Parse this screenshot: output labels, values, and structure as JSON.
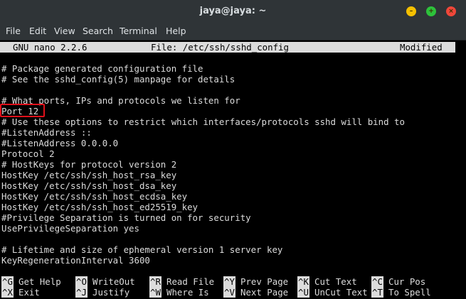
{
  "window": {
    "title": "jaya@jaya: ~",
    "buttons": {
      "minimize": "minimize",
      "maximize": "maximize",
      "close": "close"
    }
  },
  "menu": [
    "File",
    "Edit",
    "View",
    "Search",
    "Terminal",
    "Help"
  ],
  "nano": {
    "version": "GNU nano 2.2.6",
    "file": "File: /etc/ssh/sshd_config",
    "status": "Modified"
  },
  "file_lines": [
    "# Package generated configuration file",
    "# See the sshd_config(5) manpage for details",
    "",
    "# What ports, IPs and protocols we listen for",
    "Port 12",
    "# Use these options to restrict which interfaces/protocols sshd will bind to",
    "#ListenAddress ::",
    "#ListenAddress 0.0.0.0",
    "Protocol 2",
    "# HostKeys for protocol version 2",
    "HostKey /etc/ssh/ssh_host_rsa_key",
    "HostKey /etc/ssh/ssh_host_dsa_key",
    "HostKey /etc/ssh/ssh_host_ecdsa_key",
    "HostKey /etc/ssh/ssh_host_ed25519_key",
    "#Privilege Separation is turned on for security",
    "UsePrivilegeSeparation yes",
    "",
    "# Lifetime and size of ephemeral version 1 server key",
    "KeyRegenerationInterval 3600"
  ],
  "shortcuts_row1": [
    {
      "key": "^G",
      "label": "Get Help"
    },
    {
      "key": "^O",
      "label": "WriteOut"
    },
    {
      "key": "^R",
      "label": "Read File"
    },
    {
      "key": "^Y",
      "label": "Prev Page"
    },
    {
      "key": "^K",
      "label": "Cut Text"
    },
    {
      "key": "^C",
      "label": "Cur Pos"
    }
  ],
  "shortcuts_row2": [
    {
      "key": "^X",
      "label": "Exit"
    },
    {
      "key": "^J",
      "label": "Justify"
    },
    {
      "key": "^W",
      "label": "Where Is"
    },
    {
      "key": "^V",
      "label": "Next Page"
    },
    {
      "key": "^U",
      "label": "UnCut Text"
    },
    {
      "key": "^T",
      "label": "To Spell"
    }
  ],
  "colors": {
    "titlebar": "#2f3437",
    "terminal_bg": "#000000",
    "terminal_fg": "#dcdcdc",
    "highlight": "#e0101a"
  }
}
